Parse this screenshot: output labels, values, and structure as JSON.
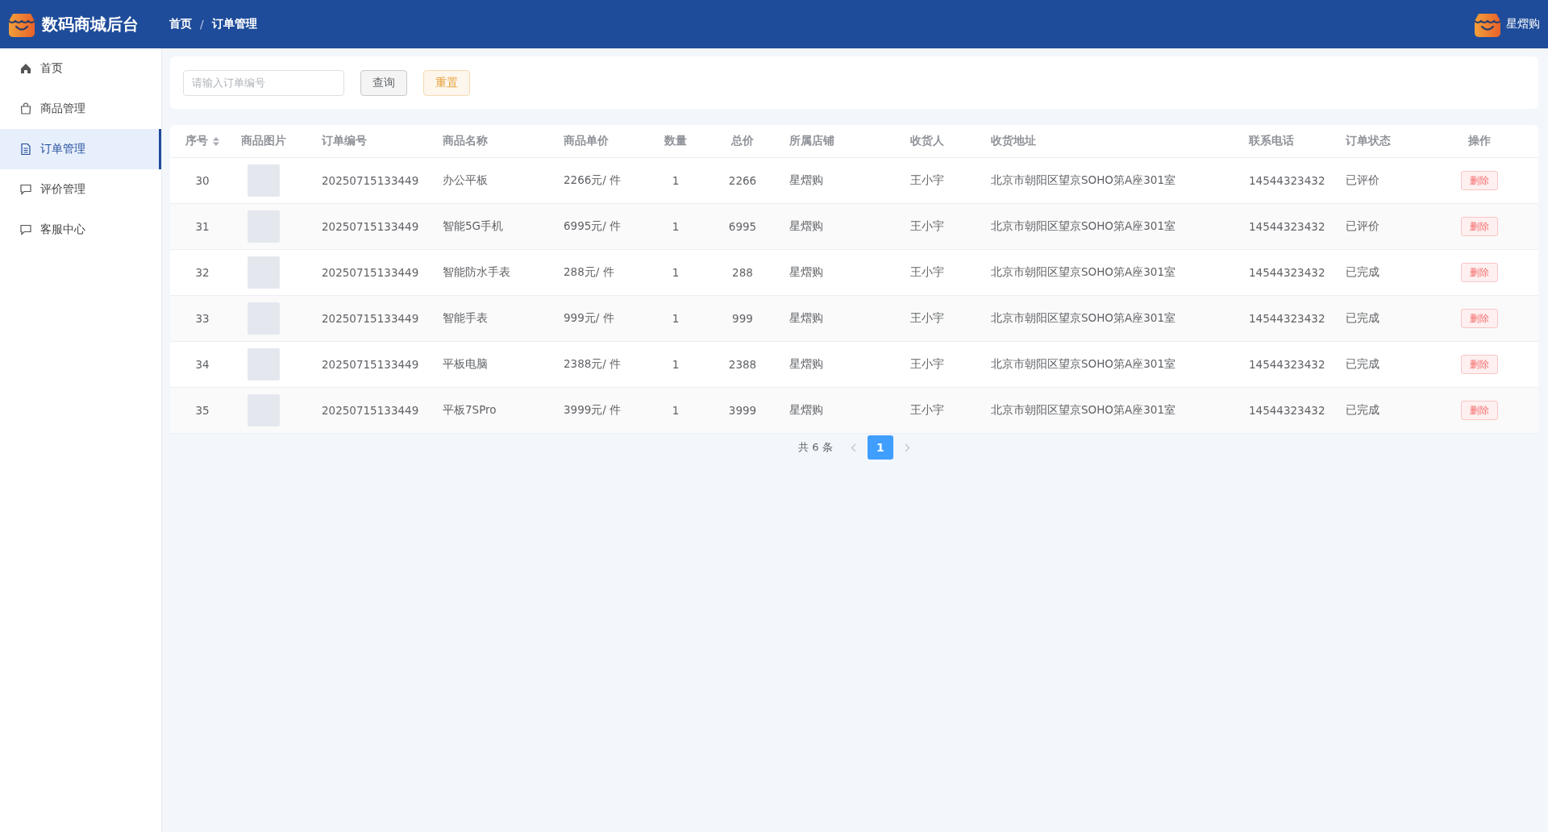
{
  "app": {
    "title": "数码商城后台",
    "breadcrumb": [
      "首页",
      "订单管理"
    ],
    "breadcrumb_separator": "/",
    "user": "星熠购"
  },
  "sidebar": {
    "items": [
      {
        "label": "首页",
        "selected": false
      },
      {
        "label": "商品管理",
        "selected": false
      },
      {
        "label": "订单管理",
        "selected": true
      },
      {
        "label": "评价管理",
        "selected": false
      },
      {
        "label": "客服中心",
        "selected": false
      }
    ]
  },
  "search": {
    "placeholder": "请输入订单编号",
    "buttons": [
      {
        "label": "查询",
        "kind": "default"
      },
      {
        "label": "重置",
        "kind": "warning"
      }
    ]
  },
  "table": {
    "columns": [
      {
        "label": "序号",
        "sortable": true
      },
      {
        "label": "商品图片",
        "sortable": false
      },
      {
        "label": "订单编号",
        "sortable": false
      },
      {
        "label": "商品名称",
        "sortable": false
      },
      {
        "label": "商品单价",
        "sortable": false
      },
      {
        "label": "数量",
        "sortable": false
      },
      {
        "label": "总价",
        "sortable": false
      },
      {
        "label": "所属店铺",
        "sortable": false
      },
      {
        "label": "收货人",
        "sortable": false
      },
      {
        "label": "收货地址",
        "sortable": false
      },
      {
        "label": "联系电话",
        "sortable": false
      },
      {
        "label": "订单状态",
        "sortable": false
      },
      {
        "label": "操作",
        "sortable": false
      }
    ],
    "rows": [
      {
        "seq": "30",
        "order_no": "20250715133449",
        "name": "办公平板",
        "price": "2266元/ 件",
        "qty": "1",
        "total": "2266",
        "store": "星熠购",
        "receiver": "王小宇",
        "address": "北京市朝阳区望京SOHO第A座301室",
        "phone": "14544323432",
        "status": "已评价",
        "action": "删除"
      },
      {
        "seq": "31",
        "order_no": "20250715133449",
        "name": "智能5G手机",
        "price": "6995元/ 件",
        "qty": "1",
        "total": "6995",
        "store": "星熠购",
        "receiver": "王小宇",
        "address": "北京市朝阳区望京SOHO第A座301室",
        "phone": "14544323432",
        "status": "已评价",
        "action": "删除"
      },
      {
        "seq": "32",
        "order_no": "20250715133449",
        "name": "智能防水手表",
        "price": "288元/ 件",
        "qty": "1",
        "total": "288",
        "store": "星熠购",
        "receiver": "王小宇",
        "address": "北京市朝阳区望京SOHO第A座301室",
        "phone": "14544323432",
        "status": "已完成",
        "action": "删除"
      },
      {
        "seq": "33",
        "order_no": "20250715133449",
        "name": "智能手表",
        "price": "999元/ 件",
        "qty": "1",
        "total": "999",
        "store": "星熠购",
        "receiver": "王小宇",
        "address": "北京市朝阳区望京SOHO第A座301室",
        "phone": "14544323432",
        "status": "已完成",
        "action": "删除"
      },
      {
        "seq": "34",
        "order_no": "20250715133449",
        "name": "平板电脑",
        "price": "2388元/ 件",
        "qty": "1",
        "total": "2388",
        "store": "星熠购",
        "receiver": "王小宇",
        "address": "北京市朝阳区望京SOHO第A座301室",
        "phone": "14544323432",
        "status": "已完成",
        "action": "删除"
      },
      {
        "seq": "35",
        "order_no": "20250715133449",
        "name": "平板7SPro",
        "price": "3999元/ 件",
        "qty": "1",
        "total": "3999",
        "store": "星熠购",
        "receiver": "王小宇",
        "address": "北京市朝阳区望京SOHO第A座301室",
        "phone": "14544323432",
        "status": "已完成",
        "action": "删除"
      }
    ]
  },
  "pagination": {
    "total": "共 6 条",
    "pages": [
      {
        "label": "1",
        "selected": true
      }
    ]
  }
}
